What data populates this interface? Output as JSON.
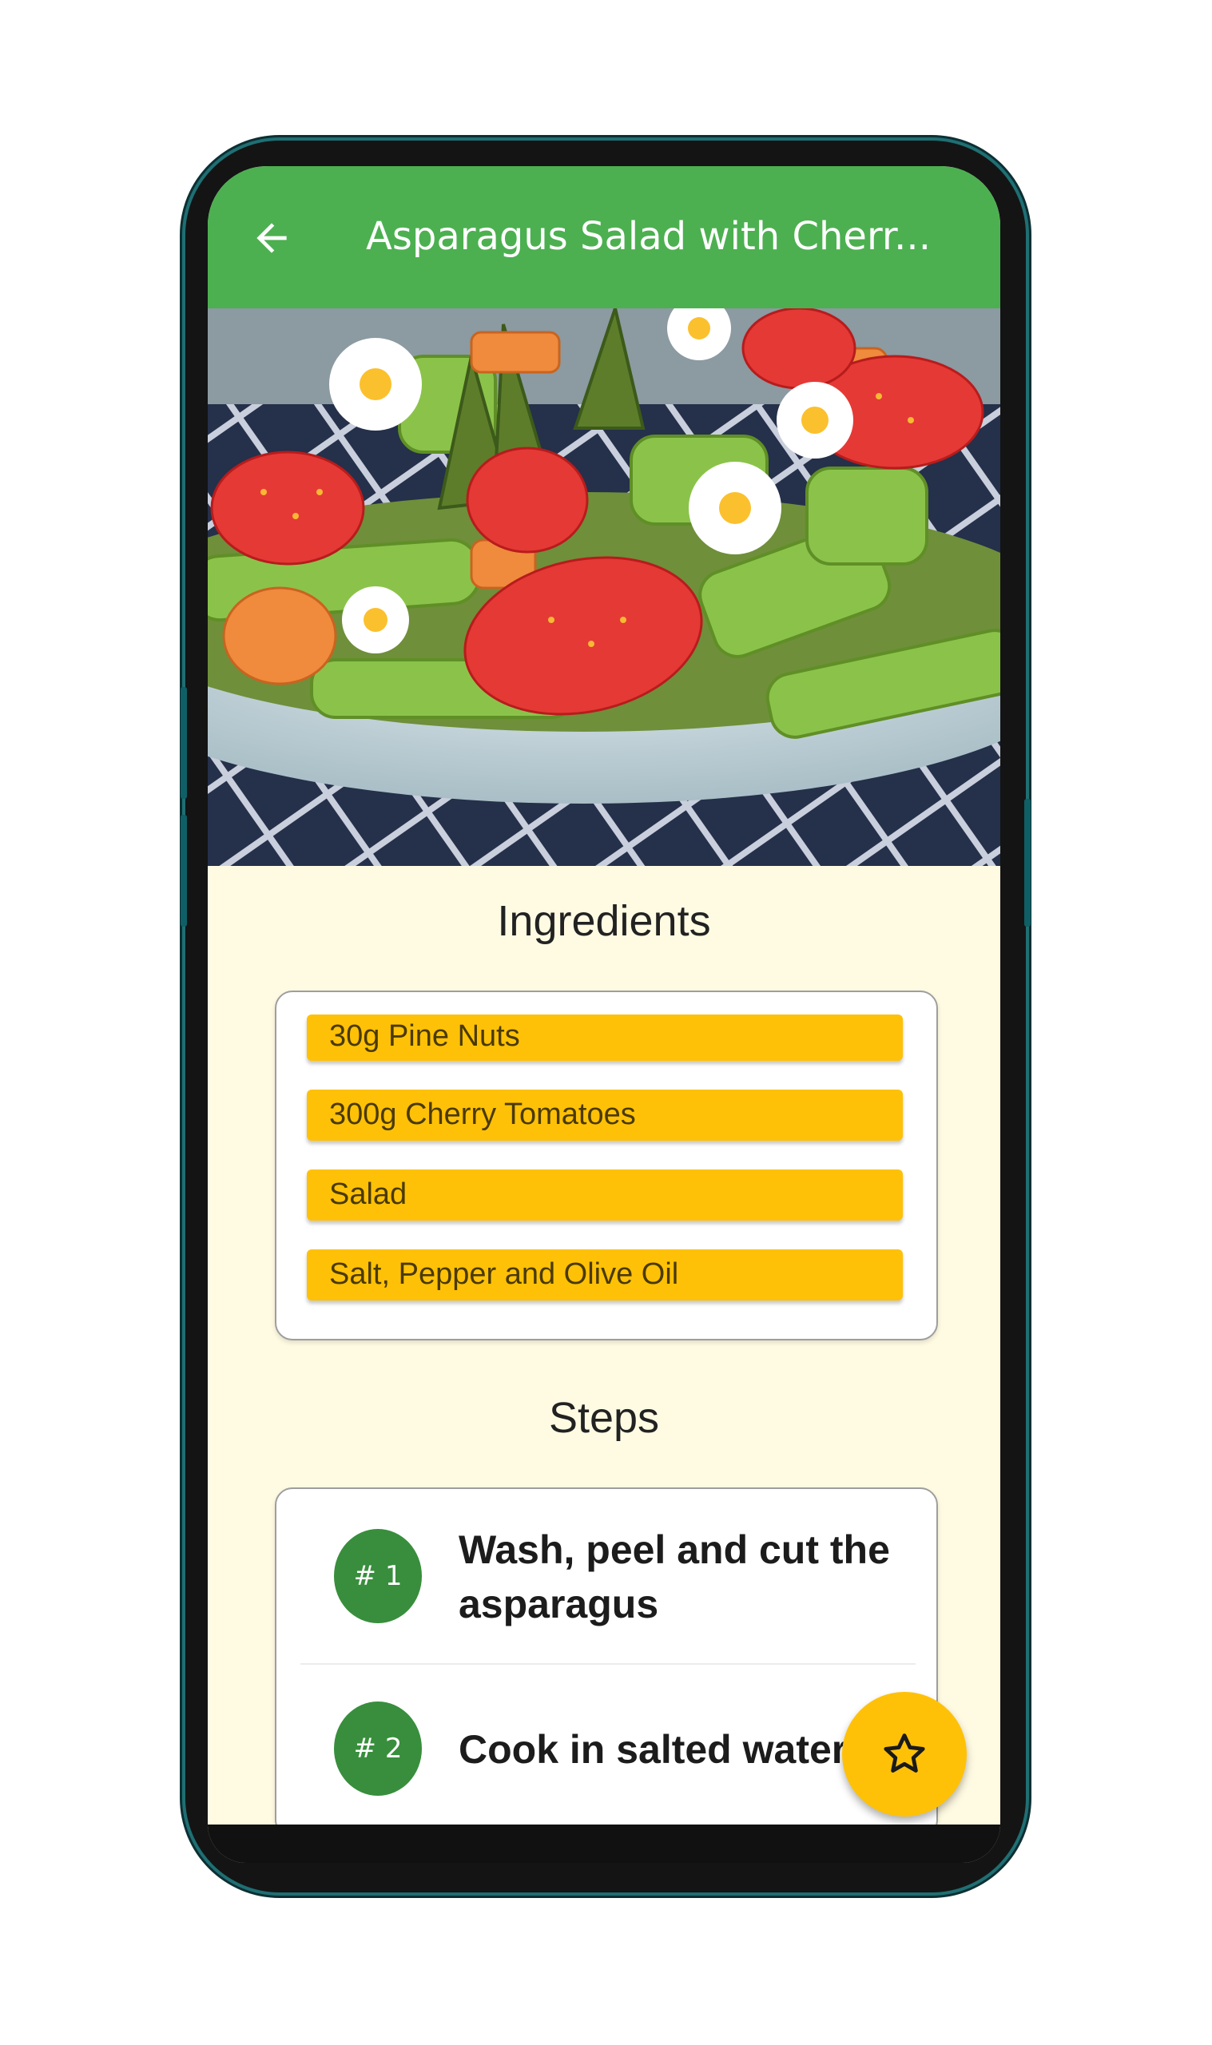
{
  "app_bar": {
    "title": "Asparagus Salad with Cherr...",
    "back_icon": "arrow-back-icon"
  },
  "hero": {
    "image_icon": "salad-photo"
  },
  "ingredients": {
    "heading": "Ingredients",
    "items": [
      "30g Pine Nuts",
      "300g Cherry Tomatoes",
      "Salad",
      "Salt, Pepper and Olive Oil"
    ]
  },
  "steps": {
    "heading": "Steps",
    "items": [
      {
        "number": "# 1",
        "text": "Wash, peel and cut the asparagus"
      },
      {
        "number": "# 2",
        "text": "Cook in salted water"
      }
    ]
  },
  "fab": {
    "icon": "star-outline-icon"
  },
  "colors": {
    "app_bar": "#4cb050",
    "background": "#fffbe3",
    "ingredient_chip": "#ffc107",
    "step_badge": "#388e3c",
    "fab": "#ffc107"
  }
}
